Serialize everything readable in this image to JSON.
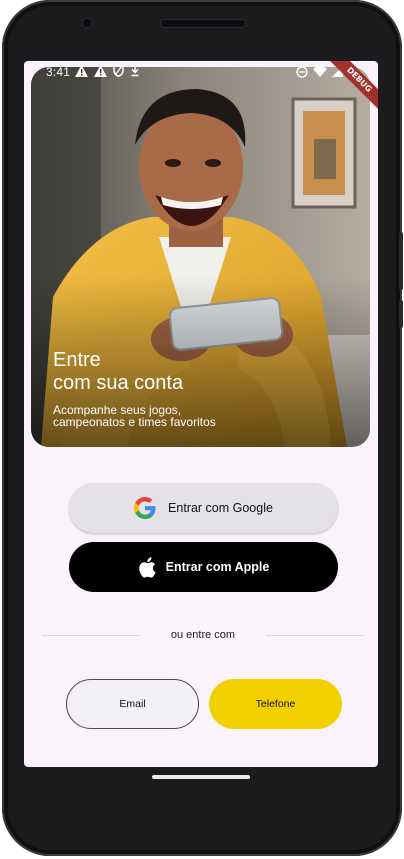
{
  "status_bar": {
    "time": "3:41",
    "left_icons": [
      "warning-icon",
      "warning-icon",
      "shield-icon",
      "download-icon"
    ],
    "right_icons": [
      "dnd-icon",
      "wifi-icon",
      "signal-icon",
      "battery-icon"
    ]
  },
  "debug_banner": "DEBUG",
  "hero": {
    "title": "Entre\ncom sua conta",
    "subtitle": "Acompanhe seus jogos, campeonatos e times favoritos"
  },
  "buttons": {
    "google_label": "Entrar com Google",
    "apple_label": "Entrar com Apple"
  },
  "divider": {
    "label": "ou entre com"
  },
  "options": {
    "email_label": "Email",
    "phone_label": "Telefone"
  },
  "colors": {
    "screen_bg": "#fbf3fb",
    "google_btn": "#e4e2e6",
    "apple_btn": "#000000",
    "phone_btn": "#f2d000",
    "debug": "#a3302d"
  }
}
